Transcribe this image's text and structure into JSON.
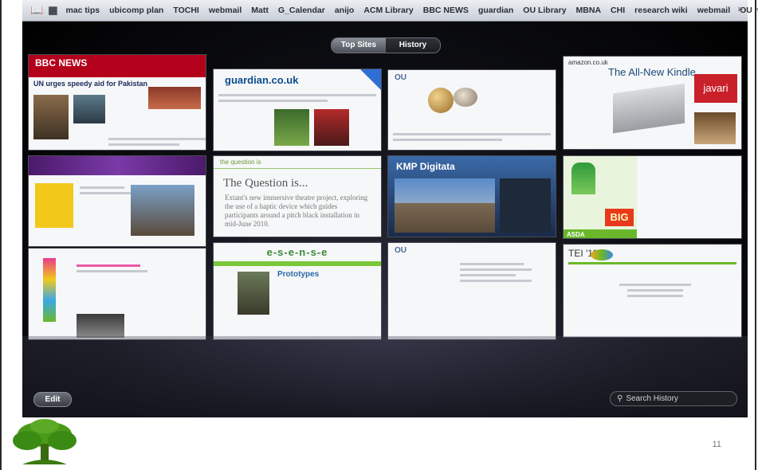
{
  "bookmarks": {
    "icons": [
      "book-icon",
      "grid-icon"
    ],
    "items": [
      "mac tips",
      "ubicomp plan",
      "TOCHI",
      "webmail",
      "Matt",
      "G_Calendar",
      "anijo",
      "ACM Library",
      "BBC NEWS",
      "guardian",
      "OU Library",
      "MBNA",
      "CHI",
      "research wiki",
      "webmail",
      "OU mail"
    ],
    "overflow": "»"
  },
  "top_sites": {
    "mode_toggle": {
      "top_sites": "Top Sites",
      "history": "History",
      "selected": "Top Sites"
    },
    "tiles": [
      {
        "row": 1,
        "site": "BBC NEWS",
        "headline": "UN urges speedy aid for Pakistan"
      },
      {
        "row": 1,
        "site": "guardian.co.uk",
        "headline": ""
      },
      {
        "row": 1,
        "site": "OU",
        "headline": ""
      },
      {
        "row": 1,
        "site": "amazon.co.uk",
        "headline": "The All-New Kindle",
        "extra": "javari"
      },
      {
        "row": 2,
        "site": "",
        "headline": ""
      },
      {
        "row": 2,
        "site": "the question is",
        "headline": "The Question is...",
        "body": "Extant's new immersive theatre project, exploring the use of a haptic device which guides participants around a pitch black installation in mid-June 2010."
      },
      {
        "row": 2,
        "site": "KMP Digitata",
        "headline": "KMP Digitata"
      },
      {
        "row": 2,
        "site": "ASDA",
        "headline": "BIG",
        "extra": "ASDA"
      },
      {
        "row": 3,
        "site": "",
        "headline": ""
      },
      {
        "row": 3,
        "site": "e-s-e-n-s-e",
        "headline": "Prototypes"
      },
      {
        "row": 3,
        "site": "OU",
        "headline": ""
      },
      {
        "row": 3,
        "site": "TEI '11",
        "headline": "TEI '11"
      }
    ],
    "edit_label": "Edit",
    "search_placeholder": "Search History"
  },
  "slide": {
    "number": "11",
    "logo_icon": "tree-icon"
  }
}
